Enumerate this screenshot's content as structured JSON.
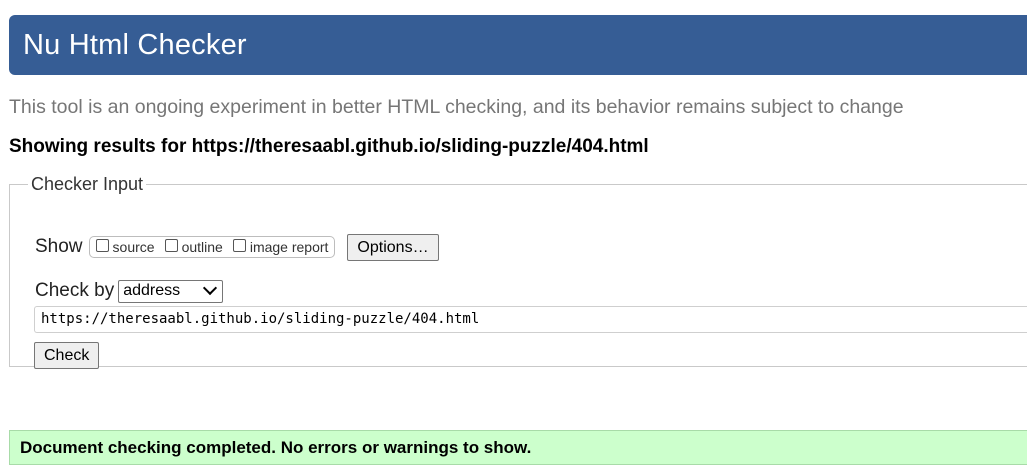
{
  "header": {
    "title": "Nu Html Checker"
  },
  "tagline": "This tool is an ongoing experiment in better HTML checking, and its behavior remains subject to change",
  "results_heading": "Showing results for https://theresaabl.github.io/sliding-puzzle/404.html",
  "checker_input": {
    "legend": "Checker Input",
    "show_label": "Show",
    "show_options": [
      {
        "label": "source",
        "checked": false
      },
      {
        "label": "outline",
        "checked": false
      },
      {
        "label": "image report",
        "checked": false
      }
    ],
    "options_button": "Options…",
    "check_by_label": "Check by",
    "check_by_selected": "address",
    "url_value": "https://theresaabl.github.io/sliding-puzzle/404.html",
    "check_button": "Check"
  },
  "status": {
    "message": "Document checking completed. No errors or warnings to show.",
    "color": "#ccffcc"
  },
  "colors": {
    "header_bg": "#365d95",
    "tagline": "#767676"
  },
  "icons": {
    "select_chevron": "chevron-down-icon"
  }
}
